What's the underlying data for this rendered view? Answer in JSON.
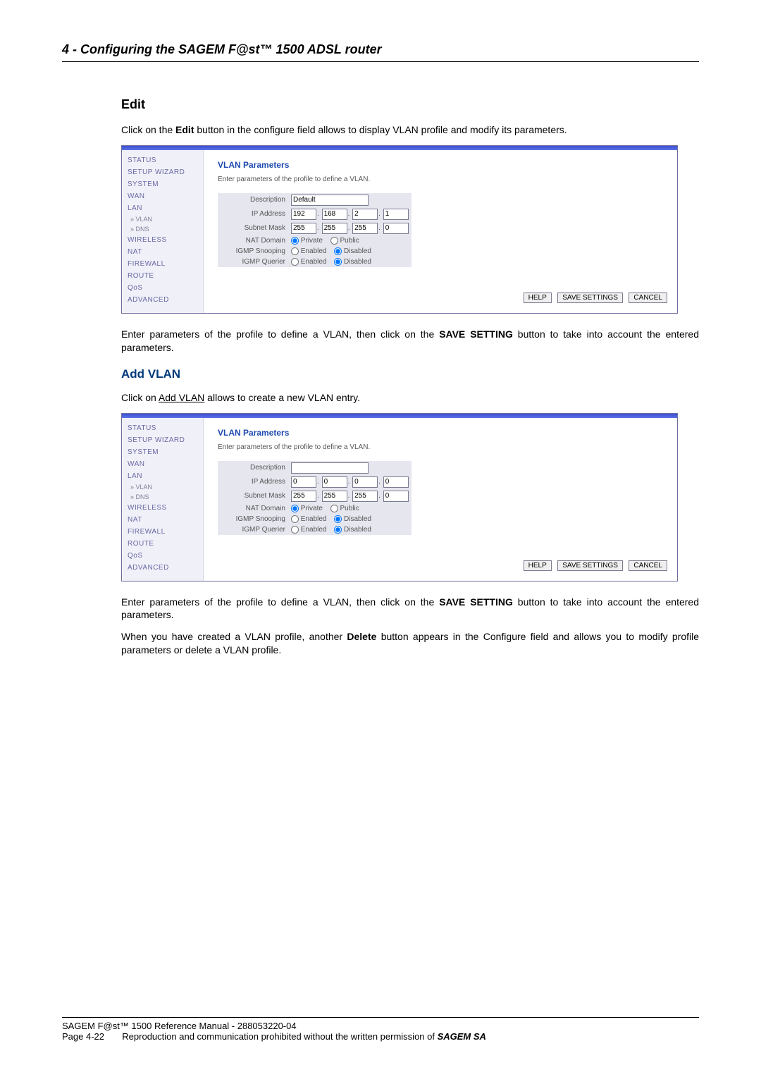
{
  "chapter_title": "4 - Configuring the SAGEM F@st™ 1500 ADSL router",
  "edit": {
    "heading": "Edit",
    "intro_prefix": "Click on the ",
    "intro_bold": "Edit",
    "intro_suffix": " button in the configure field allows to display VLAN profile and modify its parameters.",
    "after_prefix": "Enter parameters of the profile to define a VLAN, then click on the ",
    "after_bold": "SAVE SETTING",
    "after_suffix": " button to take into account the entered parameters."
  },
  "add": {
    "heading": "Add VLAN",
    "intro_prefix": "Click on ",
    "intro_ul": "Add VLAN",
    "intro_suffix": " allows to create a new VLAN entry.",
    "after_prefix": "Enter parameters of the profile to define a VLAN, then click on the ",
    "after_bold": "SAVE SETTING",
    "after_suffix": " button to take into account the entered parameters.",
    "note_prefix": "When you have created a VLAN profile, another ",
    "note_bold": "Delete",
    "note_suffix": " button appears in the Configure field and allows you to modify profile parameters or delete a VLAN profile."
  },
  "sidebar": {
    "items": [
      "STATUS",
      "SETUP WIZARD",
      "SYSTEM",
      "WAN",
      "LAN",
      "» VLAN",
      "» DNS",
      "WIRELESS",
      "NAT",
      "FIREWALL",
      "ROUTE",
      "QoS",
      "ADVANCED"
    ]
  },
  "panel": {
    "title": "VLAN Parameters",
    "desc": "Enter parameters of the profile to define a VLAN.",
    "labels": {
      "description": "Description",
      "ip": "IP Address",
      "mask": "Subnet Mask",
      "nat": "NAT Domain",
      "snoop": "IGMP Snooping",
      "querier": "IGMP Querier"
    },
    "radio": {
      "private": "Private",
      "public": "Public",
      "enabled": "Enabled",
      "disabled": "Disabled"
    },
    "buttons": {
      "help": "HELP",
      "save": "SAVE SETTINGS",
      "cancel": "CANCEL"
    }
  },
  "shot_edit": {
    "description": "Default",
    "ip": [
      "192",
      "168",
      "2",
      "1"
    ],
    "mask": [
      "255",
      "255",
      "255",
      "0"
    ],
    "nat_private": true,
    "snoop_disabled": true,
    "querier_disabled": true
  },
  "shot_add": {
    "description": "",
    "ip": [
      "0",
      "0",
      "0",
      "0"
    ],
    "mask": [
      "255",
      "255",
      "255",
      "0"
    ],
    "nat_private": true,
    "snoop_disabled": true,
    "querier_disabled": true
  },
  "footer": {
    "line1": "SAGEM F@st™ 1500 Reference Manual - 288053220-04",
    "page": "Page 4-22",
    "line2_mid": "Reproduction and communication prohibited without the written permission of ",
    "brand": "SAGEM SA"
  }
}
